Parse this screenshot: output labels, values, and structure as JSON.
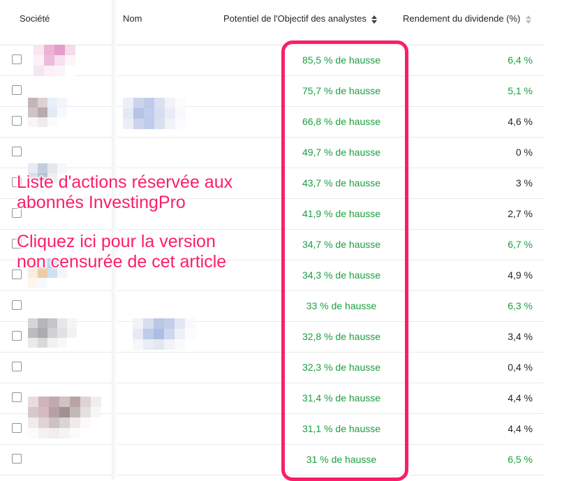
{
  "header": {
    "col_company": "Société",
    "col_name": "Nom",
    "col_potential": "Potentiel de l'Objectif des analystes",
    "col_yield": "Rendement du dividende (%)"
  },
  "rows": [
    {
      "potential": "85,5 % de hausse",
      "yield": "6,4 %",
      "yield_color": "green"
    },
    {
      "potential": "75,7 % de hausse",
      "yield": "5,1 %",
      "yield_color": "green"
    },
    {
      "potential": "66,8 % de hausse",
      "yield": "4,6 %",
      "yield_color": "dark"
    },
    {
      "potential": "49,7 % de hausse",
      "yield": "0 %",
      "yield_color": "dark"
    },
    {
      "potential": "43,7 % de hausse",
      "yield": "3 %",
      "yield_color": "dark"
    },
    {
      "potential": "41,9 % de hausse",
      "yield": "2,7 %",
      "yield_color": "dark"
    },
    {
      "potential": "34,7 % de hausse",
      "yield": "6,7 %",
      "yield_color": "green"
    },
    {
      "potential": "34,3 % de hausse",
      "yield": "4,9 %",
      "yield_color": "dark"
    },
    {
      "potential": "33 % de hausse",
      "yield": "6,3 %",
      "yield_color": "green"
    },
    {
      "potential": "32,8 % de hausse",
      "yield": "3,4 %",
      "yield_color": "dark"
    },
    {
      "potential": "32,3 % de hausse",
      "yield": "0,4 %",
      "yield_color": "dark"
    },
    {
      "potential": "31,4 % de hausse",
      "yield": "4,4 %",
      "yield_color": "dark"
    },
    {
      "potential": "31,1 % de hausse",
      "yield": "4,4 %",
      "yield_color": "dark"
    },
    {
      "potential": "31 % de hausse",
      "yield": "6,5 %",
      "yield_color": "green"
    }
  ],
  "promo": {
    "line1": "Liste d'actions réservée aux",
    "line2": "abonnés InvestingPro",
    "line3": "Cliquez ici pour la version",
    "line4": "non censurée de cet article"
  },
  "colors": {
    "accent": "#fa1e6a",
    "positive": "#1a9e3f",
    "text": "#1f2328"
  }
}
